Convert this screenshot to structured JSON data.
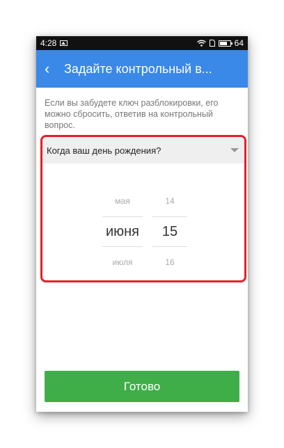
{
  "status_bar": {
    "time": "4:28",
    "battery_level": "64"
  },
  "app_bar": {
    "back_icon": "chevron-left-icon",
    "title": "Задайте контрольный в..."
  },
  "info_text": "Если вы забудете ключ разблокировки, его можно сбросить, ответив на контрольный вопрос.",
  "question": {
    "label": "Когда ваш день рождения?"
  },
  "date_picker": {
    "month": {
      "prev": "мая",
      "current": "июня",
      "next": "июля"
    },
    "day": {
      "prev": "14",
      "current": "15",
      "next": "16"
    }
  },
  "done_button": {
    "label": "Готово"
  },
  "colors": {
    "accent": "#3a88e8",
    "button": "#3fae48",
    "highlight": "#e2202c"
  }
}
